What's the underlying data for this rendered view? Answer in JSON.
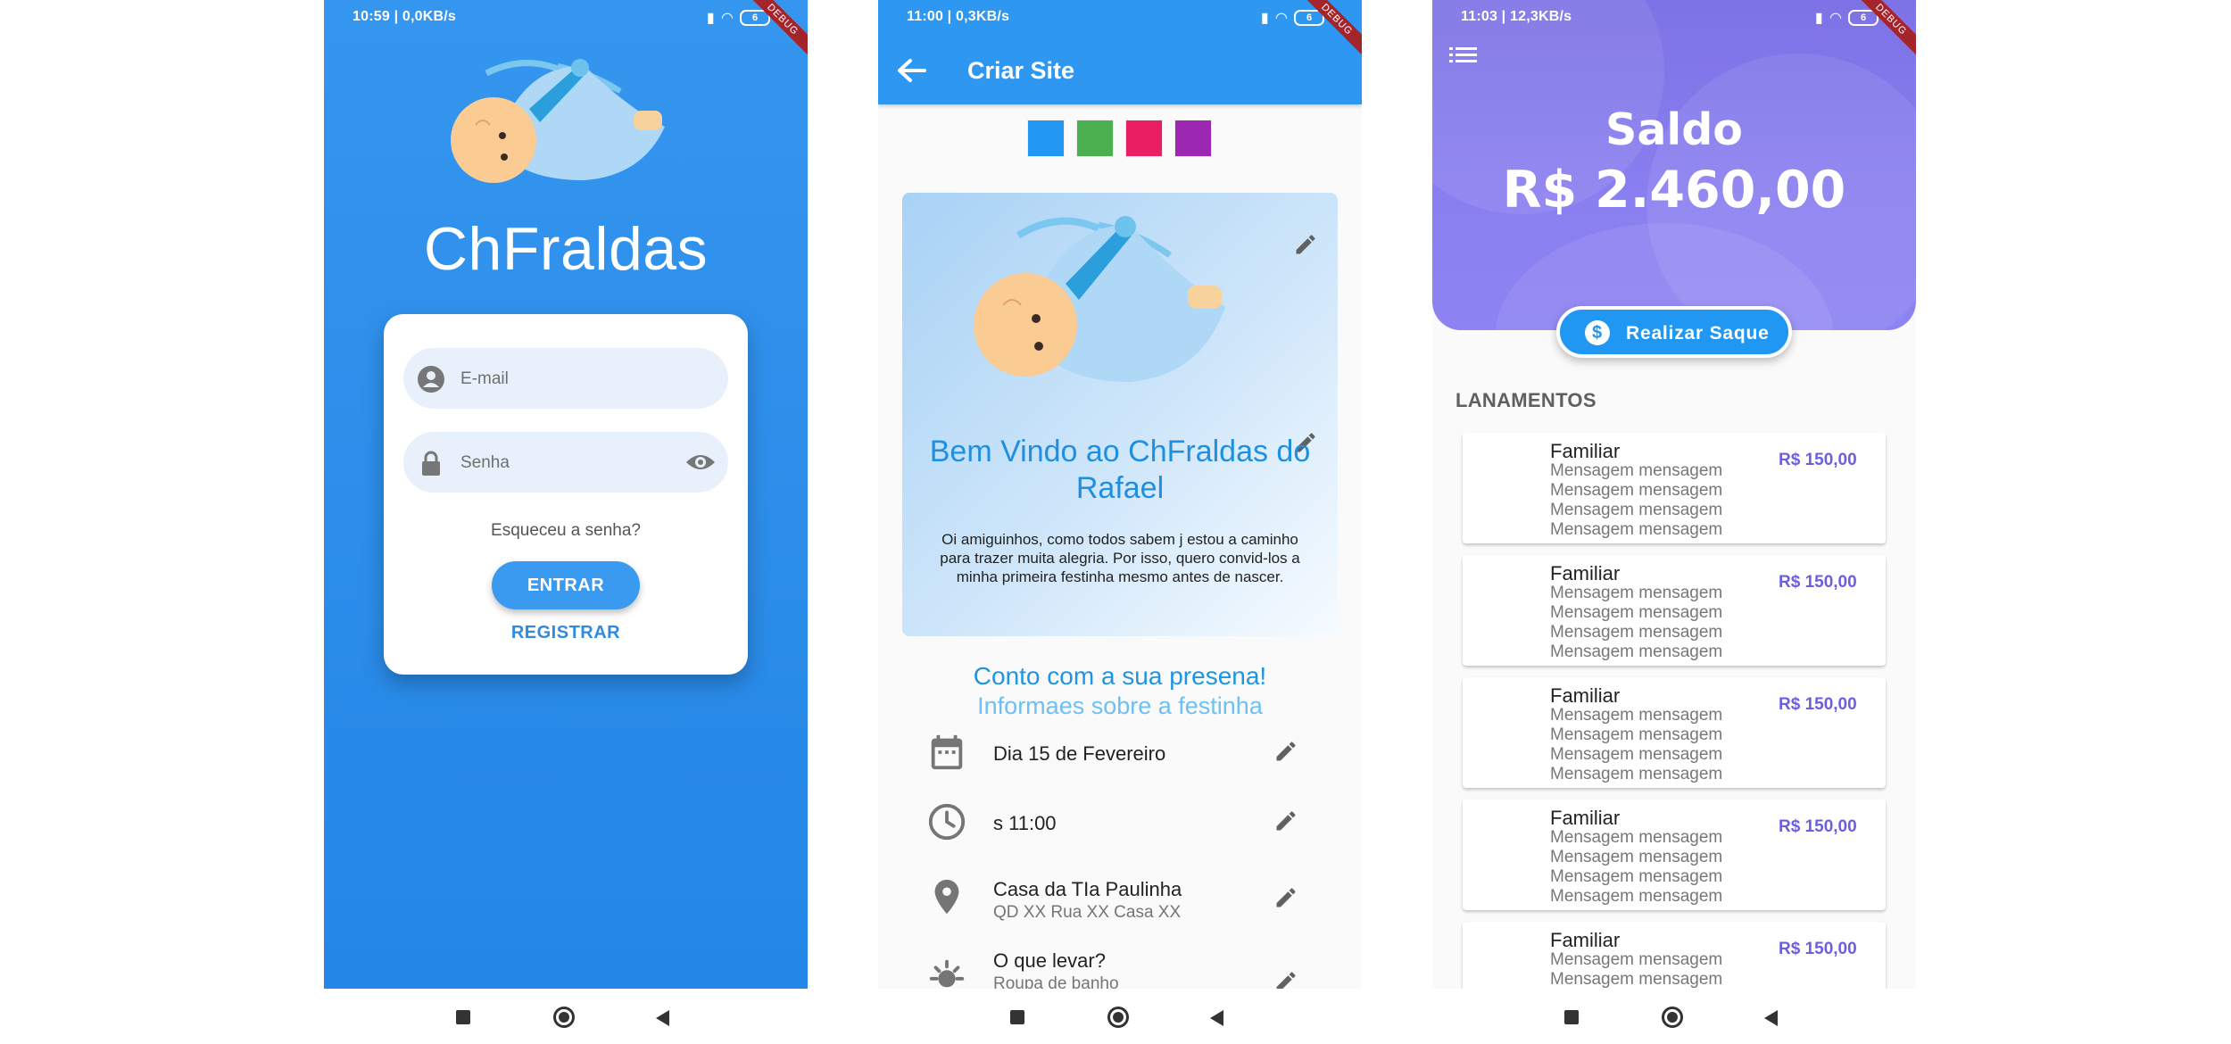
{
  "screens": {
    "login": {
      "status_left": "10:59 | 0,0KB/s",
      "app_name": "ChFraldas",
      "email_placeholder": "E-mail",
      "password_placeholder": "Senha",
      "forgot_password": "Esqueceu a senha?",
      "login_button": "ENTRAR",
      "register_link": "REGISTRAR"
    },
    "site_editor": {
      "status_left": "11:00 | 0,3KB/s",
      "title": "Criar Site",
      "color_swatches": [
        "#2196f3",
        "#4caf50",
        "#e91e63",
        "#9c27b0"
      ],
      "welcome_title": "Bem Vindo ao ChFraldas do Rafael",
      "welcome_message": "Oi amiguinhos, como todos sabem j estou a caminho para trazer muita alegria. Por isso, quero convid-los a minha primeira festinha mesmo antes de nascer.",
      "presence_title": "Conto com a sua presena!",
      "party_info_title": "Informaes sobre a festinha",
      "details": [
        {
          "icon": "calendar-icon",
          "text": "Dia 15 de Fevereiro",
          "sub": ""
        },
        {
          "icon": "clock-icon",
          "text": "s 11:00",
          "sub": ""
        },
        {
          "icon": "location-pin-icon",
          "text": "Casa da TIa Paulinha",
          "sub": "QD XX Rua XX Casa XX"
        },
        {
          "icon": "sun-icon",
          "text": "O que levar?",
          "sub": "Roupa de banho"
        }
      ]
    },
    "balance": {
      "status_left": "11:03 | 12,3KB/s",
      "balance_title": "Saldo",
      "balance_value": "R$ 2.460,00",
      "withdraw_button": "Realizar Saque",
      "entries_title": "LANAMENTOS",
      "entries": [
        {
          "title": "Familiar",
          "message": "Mensagem mensagem Mensagem mensagem Mensagem mensagem Mensagem mensagem",
          "amount": "R$ 150,00"
        },
        {
          "title": "Familiar",
          "message": "Mensagem mensagem Mensagem mensagem Mensagem mensagem Mensagem mensagem",
          "amount": "R$ 150,00"
        },
        {
          "title": "Familiar",
          "message": "Mensagem mensagem Mensagem mensagem Mensagem mensagem Mensagem mensagem",
          "amount": "R$ 150,00"
        },
        {
          "title": "Familiar",
          "message": "Mensagem mensagem Mensagem mensagem Mensagem mensagem Mensagem mensagem",
          "amount": "R$ 150,00"
        },
        {
          "title": "Familiar",
          "message": "Mensagem mensagem Mensagem mensagem",
          "amount": "R$ 150,00"
        }
      ]
    }
  },
  "status_bar": {
    "battery": "6",
    "debug_banner": "DEBUG"
  },
  "colors": {
    "primary_blue": "#2e97f2",
    "accent_purple": "#7d72e6",
    "amount_purple": "#6b5fe0"
  }
}
